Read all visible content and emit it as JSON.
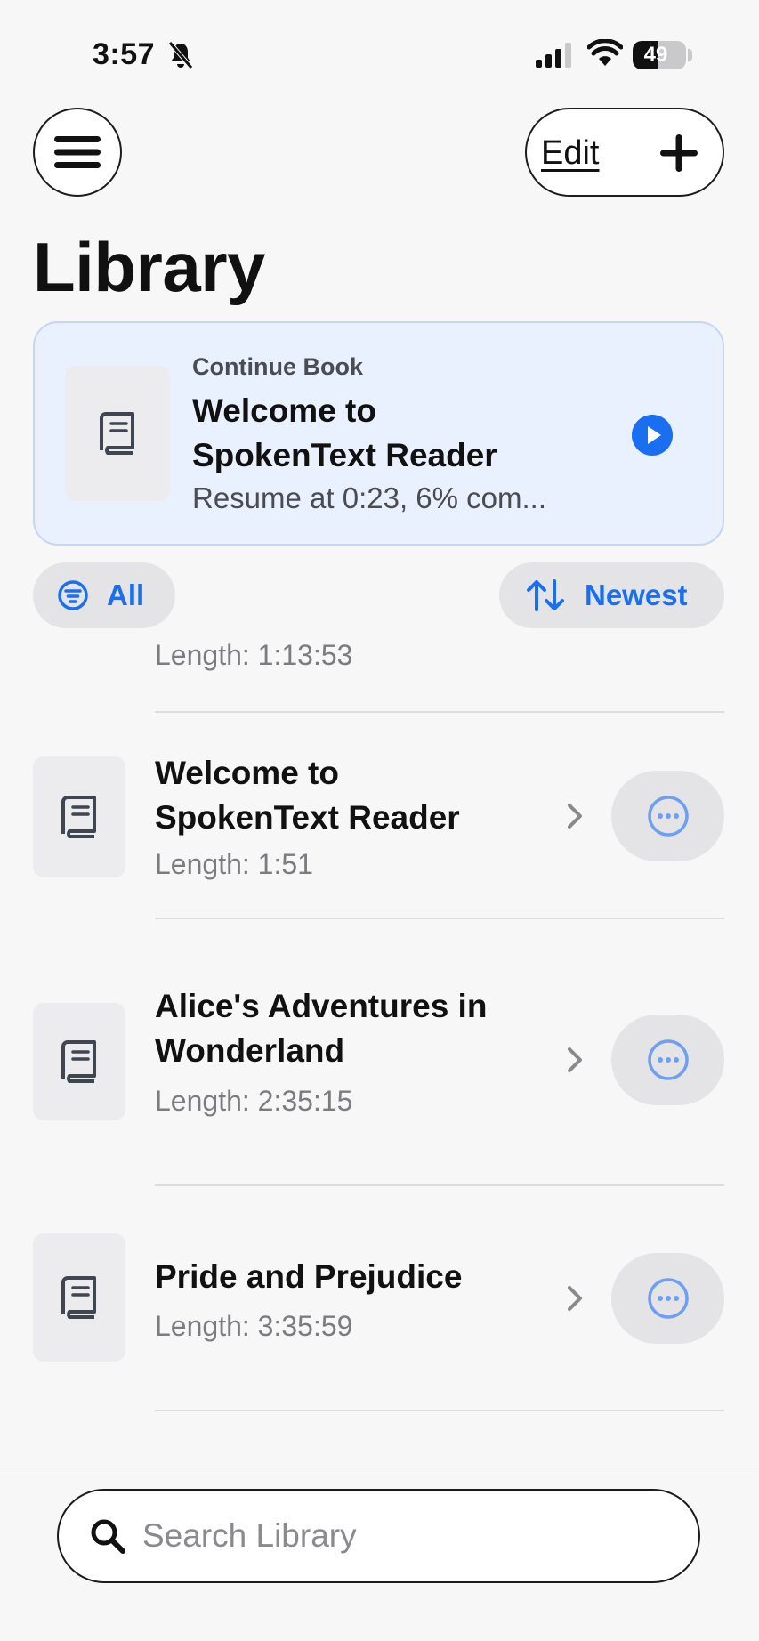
{
  "status_bar": {
    "time": "3:57",
    "battery_level": "49",
    "battery_fraction": 0.49,
    "icons": [
      "bell-slash-icon",
      "cellular-signal-icon",
      "wifi-icon",
      "battery-icon"
    ]
  },
  "header": {
    "menu_icon": "hamburger-icon",
    "edit_label": "Edit",
    "add_icon": "plus-icon"
  },
  "page_title": "Library",
  "continue_card": {
    "kicker": "Continue Book",
    "title": "Welcome to SpokenText Reader",
    "progress": "Resume at 0:23, 6% com...",
    "cover_icon": "book-icon",
    "play_icon": "play-circle-icon"
  },
  "filters": {
    "filter_label": "All",
    "filter_icon": "filter-circle-icon",
    "sort_label": "Newest",
    "sort_icon": "sort-arrows-icon"
  },
  "partial_item": {
    "length": "Length: 1:13:53"
  },
  "items": [
    {
      "title": "Welcome to SpokenText Reader",
      "length": "Length: 1:51"
    },
    {
      "title": "Alice's Adventures in Wonderland",
      "length": "Length: 2:35:15"
    },
    {
      "title": "Pride and Prejudice",
      "length": "Length: 3:35:59"
    }
  ],
  "search": {
    "placeholder": "Search Library"
  },
  "colors": {
    "accent": "#1a6ff0",
    "card_background": "#e9f0fe",
    "chip_background": "#e4e4e7",
    "secondary_text": "#7b7b80"
  }
}
